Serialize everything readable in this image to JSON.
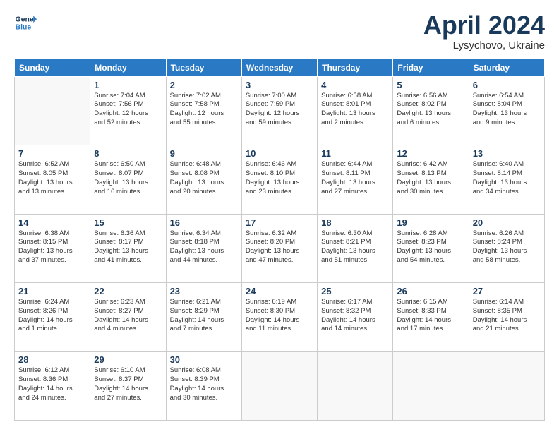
{
  "header": {
    "logo_line1": "General",
    "logo_line2": "Blue",
    "month": "April 2024",
    "location": "Lysychovo, Ukraine"
  },
  "weekdays": [
    "Sunday",
    "Monday",
    "Tuesday",
    "Wednesday",
    "Thursday",
    "Friday",
    "Saturday"
  ],
  "weeks": [
    [
      {
        "day": "",
        "info": ""
      },
      {
        "day": "1",
        "info": "Sunrise: 7:04 AM\nSunset: 7:56 PM\nDaylight: 12 hours\nand 52 minutes."
      },
      {
        "day": "2",
        "info": "Sunrise: 7:02 AM\nSunset: 7:58 PM\nDaylight: 12 hours\nand 55 minutes."
      },
      {
        "day": "3",
        "info": "Sunrise: 7:00 AM\nSunset: 7:59 PM\nDaylight: 12 hours\nand 59 minutes."
      },
      {
        "day": "4",
        "info": "Sunrise: 6:58 AM\nSunset: 8:01 PM\nDaylight: 13 hours\nand 2 minutes."
      },
      {
        "day": "5",
        "info": "Sunrise: 6:56 AM\nSunset: 8:02 PM\nDaylight: 13 hours\nand 6 minutes."
      },
      {
        "day": "6",
        "info": "Sunrise: 6:54 AM\nSunset: 8:04 PM\nDaylight: 13 hours\nand 9 minutes."
      }
    ],
    [
      {
        "day": "7",
        "info": "Sunrise: 6:52 AM\nSunset: 8:05 PM\nDaylight: 13 hours\nand 13 minutes."
      },
      {
        "day": "8",
        "info": "Sunrise: 6:50 AM\nSunset: 8:07 PM\nDaylight: 13 hours\nand 16 minutes."
      },
      {
        "day": "9",
        "info": "Sunrise: 6:48 AM\nSunset: 8:08 PM\nDaylight: 13 hours\nand 20 minutes."
      },
      {
        "day": "10",
        "info": "Sunrise: 6:46 AM\nSunset: 8:10 PM\nDaylight: 13 hours\nand 23 minutes."
      },
      {
        "day": "11",
        "info": "Sunrise: 6:44 AM\nSunset: 8:11 PM\nDaylight: 13 hours\nand 27 minutes."
      },
      {
        "day": "12",
        "info": "Sunrise: 6:42 AM\nSunset: 8:13 PM\nDaylight: 13 hours\nand 30 minutes."
      },
      {
        "day": "13",
        "info": "Sunrise: 6:40 AM\nSunset: 8:14 PM\nDaylight: 13 hours\nand 34 minutes."
      }
    ],
    [
      {
        "day": "14",
        "info": "Sunrise: 6:38 AM\nSunset: 8:15 PM\nDaylight: 13 hours\nand 37 minutes."
      },
      {
        "day": "15",
        "info": "Sunrise: 6:36 AM\nSunset: 8:17 PM\nDaylight: 13 hours\nand 41 minutes."
      },
      {
        "day": "16",
        "info": "Sunrise: 6:34 AM\nSunset: 8:18 PM\nDaylight: 13 hours\nand 44 minutes."
      },
      {
        "day": "17",
        "info": "Sunrise: 6:32 AM\nSunset: 8:20 PM\nDaylight: 13 hours\nand 47 minutes."
      },
      {
        "day": "18",
        "info": "Sunrise: 6:30 AM\nSunset: 8:21 PM\nDaylight: 13 hours\nand 51 minutes."
      },
      {
        "day": "19",
        "info": "Sunrise: 6:28 AM\nSunset: 8:23 PM\nDaylight: 13 hours\nand 54 minutes."
      },
      {
        "day": "20",
        "info": "Sunrise: 6:26 AM\nSunset: 8:24 PM\nDaylight: 13 hours\nand 58 minutes."
      }
    ],
    [
      {
        "day": "21",
        "info": "Sunrise: 6:24 AM\nSunset: 8:26 PM\nDaylight: 14 hours\nand 1 minute."
      },
      {
        "day": "22",
        "info": "Sunrise: 6:23 AM\nSunset: 8:27 PM\nDaylight: 14 hours\nand 4 minutes."
      },
      {
        "day": "23",
        "info": "Sunrise: 6:21 AM\nSunset: 8:29 PM\nDaylight: 14 hours\nand 7 minutes."
      },
      {
        "day": "24",
        "info": "Sunrise: 6:19 AM\nSunset: 8:30 PM\nDaylight: 14 hours\nand 11 minutes."
      },
      {
        "day": "25",
        "info": "Sunrise: 6:17 AM\nSunset: 8:32 PM\nDaylight: 14 hours\nand 14 minutes."
      },
      {
        "day": "26",
        "info": "Sunrise: 6:15 AM\nSunset: 8:33 PM\nDaylight: 14 hours\nand 17 minutes."
      },
      {
        "day": "27",
        "info": "Sunrise: 6:14 AM\nSunset: 8:35 PM\nDaylight: 14 hours\nand 21 minutes."
      }
    ],
    [
      {
        "day": "28",
        "info": "Sunrise: 6:12 AM\nSunset: 8:36 PM\nDaylight: 14 hours\nand 24 minutes."
      },
      {
        "day": "29",
        "info": "Sunrise: 6:10 AM\nSunset: 8:37 PM\nDaylight: 14 hours\nand 27 minutes."
      },
      {
        "day": "30",
        "info": "Sunrise: 6:08 AM\nSunset: 8:39 PM\nDaylight: 14 hours\nand 30 minutes."
      },
      {
        "day": "",
        "info": ""
      },
      {
        "day": "",
        "info": ""
      },
      {
        "day": "",
        "info": ""
      },
      {
        "day": "",
        "info": ""
      }
    ]
  ]
}
